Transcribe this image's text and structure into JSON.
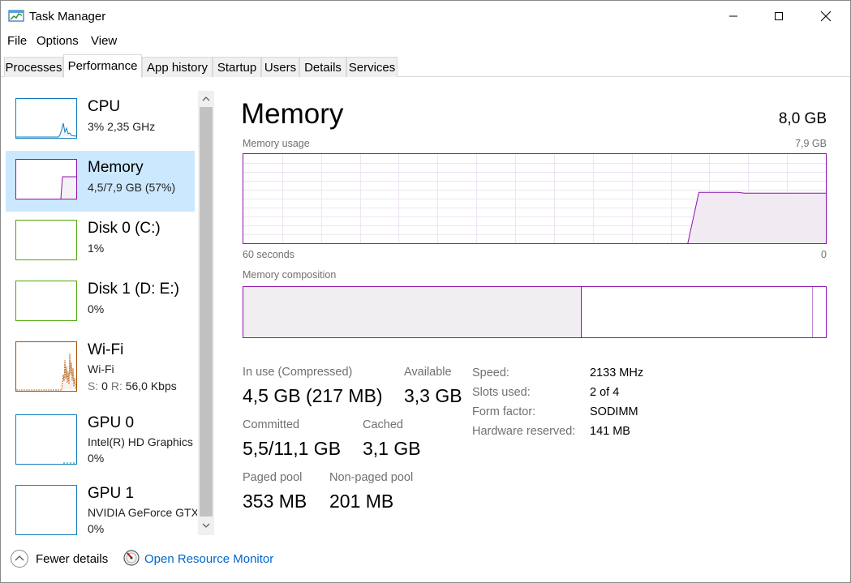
{
  "window": {
    "title": "Task Manager"
  },
  "menu": {
    "file": "File",
    "options": "Options",
    "view": "View"
  },
  "tabs": [
    {
      "label": "Processes"
    },
    {
      "label": "Performance",
      "active": true
    },
    {
      "label": "App history"
    },
    {
      "label": "Startup"
    },
    {
      "label": "Users"
    },
    {
      "label": "Details"
    },
    {
      "label": "Services"
    }
  ],
  "sidebar": {
    "items": [
      {
        "name": "CPU",
        "line1": "3%  2,35 GHz",
        "color": "#117dbb"
      },
      {
        "name": "Memory",
        "line1": "4,5/7,9 GB (57%)",
        "color": "#8b12ae",
        "selected": true
      },
      {
        "name": "Disk 0 (C:)",
        "line1": "1%",
        "color": "#4da60c"
      },
      {
        "name": "Disk 1 (D: E:)",
        "line1": "0%",
        "color": "#4da60c"
      },
      {
        "name": "Wi-Fi",
        "line1": "Wi-Fi",
        "line2_s": "S:",
        "line2_s_val": "0",
        "line2_r": "R:",
        "line2_r_val": "56,0 Kbps",
        "color": "#a74f01"
      },
      {
        "name": "GPU 0",
        "line1": "Intel(R) HD Graphics",
        "line2": "0%",
        "color": "#117dbb"
      },
      {
        "name": "GPU 1",
        "line1": "NVIDIA GeForce GTX",
        "line2": "0%",
        "color": "#117dbb"
      }
    ]
  },
  "main": {
    "title": "Memory",
    "total": "8,0 GB",
    "usage_label": "Memory usage",
    "usage_max": "7,9 GB",
    "time_left": "60 seconds",
    "time_right": "0",
    "composition_label": "Memory composition",
    "usage_percent": 57,
    "stats": {
      "in_use_label": "In use (Compressed)",
      "in_use_value": "4,5 GB (217 MB)",
      "available_label": "Available",
      "available_value": "3,3 GB",
      "committed_label": "Committed",
      "committed_value": "5,5/11,1 GB",
      "cached_label": "Cached",
      "cached_value": "3,1 GB",
      "paged_label": "Paged pool",
      "paged_value": "353 MB",
      "nonpaged_label": "Non-paged pool",
      "nonpaged_value": "201 MB"
    },
    "details": {
      "speed_label": "Speed:",
      "speed_value": "2133 MHz",
      "slots_label": "Slots used:",
      "slots_value": "2 of 4",
      "form_label": "Form factor:",
      "form_value": "SODIMM",
      "reserved_label": "Hardware reserved:",
      "reserved_value": "141 MB"
    }
  },
  "footer": {
    "fewer_details": "Fewer details",
    "open_resource_monitor": "Open Resource Monitor"
  },
  "colors": {
    "memory": "#8b12ae",
    "selection": "#cce8ff",
    "link": "#0066cc"
  }
}
